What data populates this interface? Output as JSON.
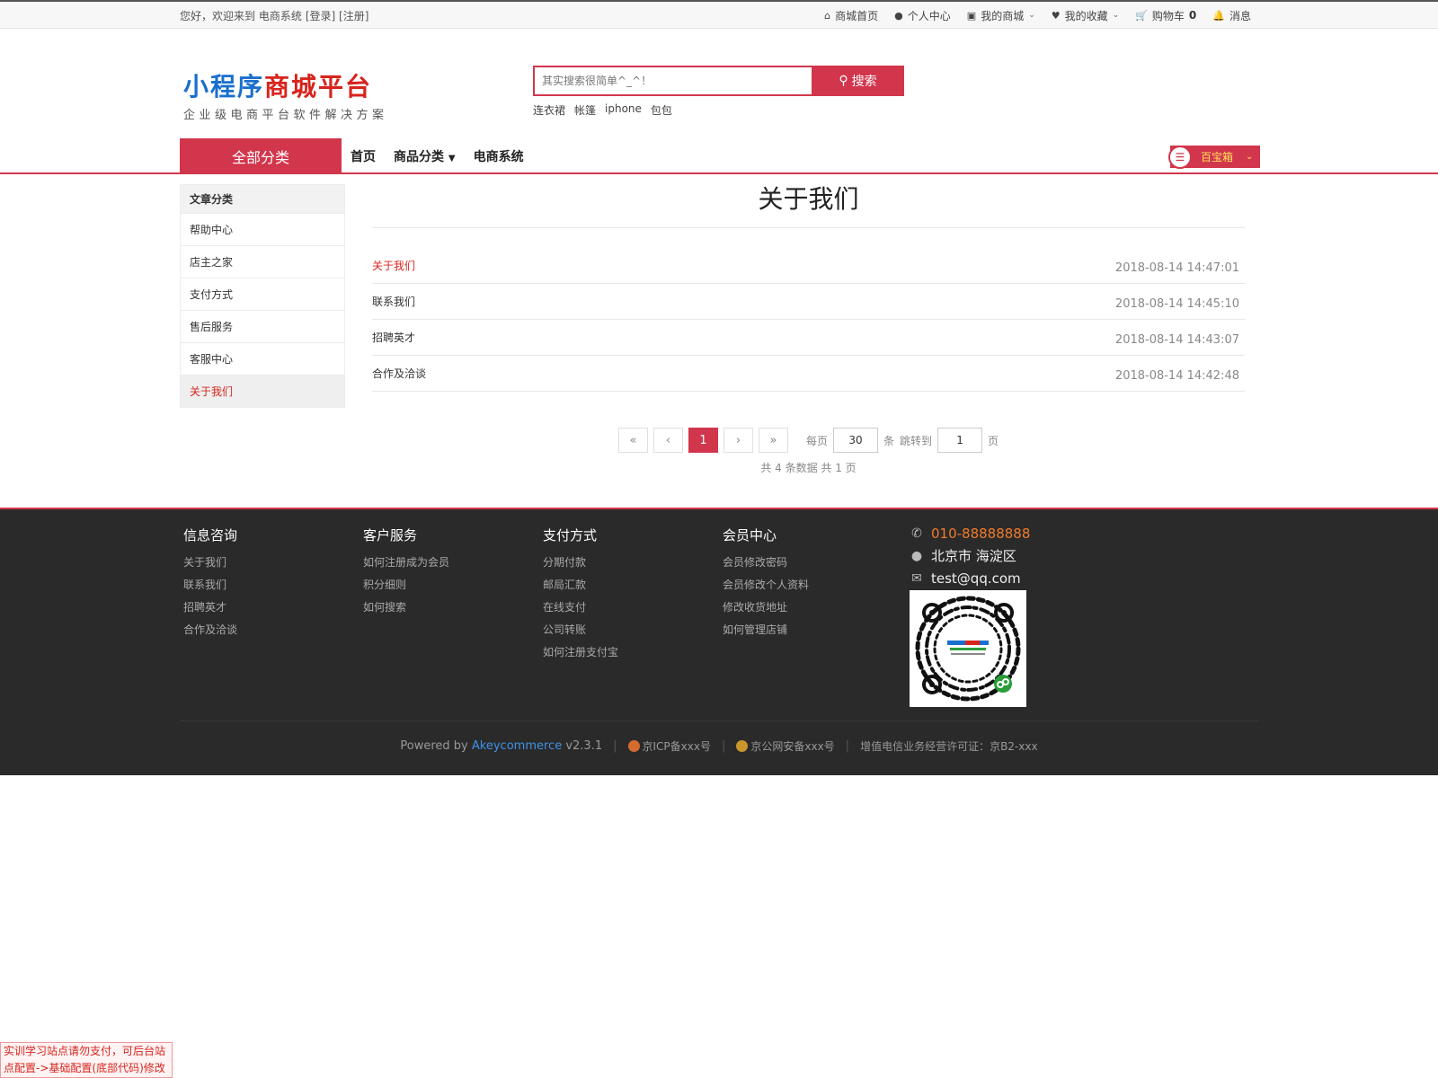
{
  "topbar": {
    "welcome": "您好，欢迎来到 电商系统",
    "login": "[登录]",
    "register": "[注册]",
    "links": {
      "home": "商城首页",
      "personal": "个人中心",
      "myshop": "我的商城",
      "favorites": "我的收藏",
      "cart": "购物车",
      "cart_count": "0",
      "messages": "消息"
    }
  },
  "header": {
    "logo_blue": "小程序",
    "logo_red": "商城平台",
    "logo_sub": "企业级电商平台软件解决方案",
    "search_placeholder": "其实搜索很简单^_^！",
    "search_button": "搜索",
    "hot": [
      "连衣裙",
      "帐篷",
      "iphone",
      "包包"
    ]
  },
  "nav": {
    "all_categories": "全部分类",
    "links": [
      "首页",
      "商品分类",
      "电商系统"
    ],
    "treasure_box": "百宝箱"
  },
  "sidebar": {
    "title": "文章分类",
    "items": [
      "帮助中心",
      "店主之家",
      "支付方式",
      "售后服务",
      "客服中心",
      "关于我们"
    ]
  },
  "content": {
    "title": "关于我们",
    "articles": [
      {
        "title": "关于我们",
        "date": "2018-08-14 14:47:01"
      },
      {
        "title": "联系我们",
        "date": "2018-08-14 14:45:10"
      },
      {
        "title": "招聘英才",
        "date": "2018-08-14 14:43:07"
      },
      {
        "title": "合作及洽谈",
        "date": "2018-08-14 14:42:48"
      }
    ],
    "pager": {
      "first": "«",
      "prev": "‹",
      "current": "1",
      "next": "›",
      "last": "»",
      "per_page_label": "每页",
      "per_page_value": "30",
      "per_page_unit": "条",
      "jump_label": "跳转到",
      "jump_value": "1",
      "jump_unit": "页",
      "info": "共 4 条数据   共 1 页"
    }
  },
  "footer": {
    "columns": [
      {
        "title": "信息咨询",
        "links": [
          "关于我们",
          "联系我们",
          "招聘英才",
          "合作及洽谈"
        ]
      },
      {
        "title": "客户服务",
        "links": [
          "如何注册成为会员",
          "积分细则",
          "如何搜索"
        ]
      },
      {
        "title": "支付方式",
        "links": [
          "分期付款",
          "邮局汇款",
          "在线支付",
          "公司转账",
          "如何注册支付宝"
        ]
      },
      {
        "title": "会员中心",
        "links": [
          "会员修改密码",
          "会员修改个人资料",
          "修改收货地址",
          "如何管理店铺"
        ]
      }
    ],
    "contact": {
      "phone": "010-88888888",
      "address": "北京市 海淀区",
      "email": "test@qq.com"
    },
    "bottom": {
      "powered": "Powered by",
      "brand": "Akeycommerce",
      "version": "v2.3.1",
      "icp": "京ICP备xxx号",
      "police": "京公网安备xxx号",
      "license": "增值电信业务经营许可证：京B2-xxx"
    }
  },
  "notice": {
    "line1": "实训学习站点请勿支付，可后台站",
    "line2": "点配置->基础配置(底部代码)修改"
  },
  "colors": {
    "accent": "#d2364c",
    "logo_blue": "#1a6fce",
    "logo_red": "#d7241d",
    "footer_bg": "#2a2a2a",
    "phone": "#f07b2c"
  }
}
